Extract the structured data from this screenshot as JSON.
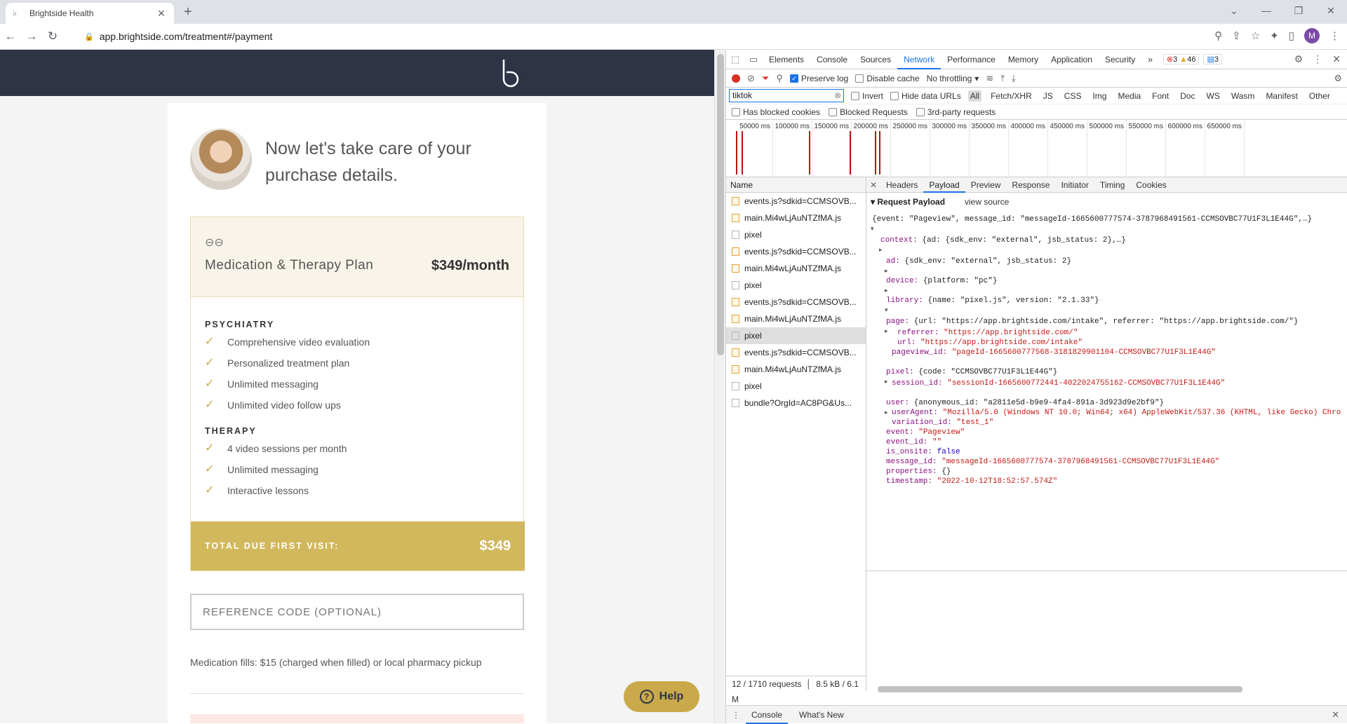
{
  "browser": {
    "tab_title": "Brightside Health",
    "url": "app.brightside.com/treatment#/payment",
    "avatar_letter": "M"
  },
  "page": {
    "heading": "Now let's take care of your purchase details.",
    "plan_name": "Medication & Therapy Plan",
    "plan_price": "$349/month",
    "psychiatry_label": "PSYCHIATRY",
    "psychiatry_items": [
      "Comprehensive video evaluation",
      "Personalized treatment plan",
      "Unlimited messaging",
      "Unlimited video follow ups"
    ],
    "therapy_label": "THERAPY",
    "therapy_items": [
      "4 video sessions per month",
      "Unlimited messaging",
      "Interactive lessons"
    ],
    "total_label": "TOTAL DUE FIRST VISIT:",
    "total_amount": "$349",
    "reference_placeholder": "REFERENCE CODE (OPTIONAL)",
    "medication_note": "Medication fills: $15 (charged when filled) or local pharmacy pickup",
    "help_label": "Help",
    "accent_color": "#c9a94a",
    "header_color": "#2e3346"
  },
  "devtools": {
    "tabs": [
      "Elements",
      "Console",
      "Sources",
      "Network",
      "Performance",
      "Memory",
      "Application",
      "Security"
    ],
    "active_tab": "Network",
    "badges": {
      "errors": "3",
      "warnings": "46",
      "messages": "3"
    },
    "toolbar": {
      "preserve_log": "Preserve log",
      "disable_cache": "Disable cache",
      "throttling": "No throttling"
    },
    "filter": {
      "value": "tiktok",
      "invert": "Invert",
      "hide_data_urls": "Hide data URLs",
      "types": [
        "All",
        "Fetch/XHR",
        "JS",
        "CSS",
        "Img",
        "Media",
        "Font",
        "Doc",
        "WS",
        "Wasm",
        "Manifest",
        "Other"
      ],
      "has_blocked_cookies": "Has blocked cookies",
      "blocked_requests": "Blocked Requests",
      "third_party": "3rd-party requests"
    },
    "timeline_ticks": [
      "50000 ms",
      "100000 ms",
      "150000 ms",
      "200000 ms",
      "250000 ms",
      "300000 ms",
      "350000 ms",
      "400000 ms",
      "450000 ms",
      "500000 ms",
      "550000 ms",
      "600000 ms",
      "650000 ms"
    ],
    "name_header": "Name",
    "requests": [
      {
        "name": "events.js?sdkid=CCMSOVB...",
        "type": "js"
      },
      {
        "name": "main.Mi4wLjAuNTZfMA.js",
        "type": "js"
      },
      {
        "name": "pixel",
        "type": "doc"
      },
      {
        "name": "events.js?sdkid=CCMSOVB...",
        "type": "js"
      },
      {
        "name": "main.Mi4wLjAuNTZfMA.js",
        "type": "js"
      },
      {
        "name": "pixel",
        "type": "doc"
      },
      {
        "name": "events.js?sdkid=CCMSOVB...",
        "type": "js"
      },
      {
        "name": "main.Mi4wLjAuNTZfMA.js",
        "type": "js"
      },
      {
        "name": "pixel",
        "type": "doc",
        "selected": true
      },
      {
        "name": "events.js?sdkid=CCMSOVB...",
        "type": "js"
      },
      {
        "name": "main.Mi4wLjAuNTZfMA.js",
        "type": "js"
      },
      {
        "name": "pixel",
        "type": "doc"
      },
      {
        "name": "bundle?OrgId=AC8PG&Us...",
        "type": "doc"
      }
    ],
    "footer_requests": "12 / 1710 requests",
    "footer_size": "8.5 kB / 6.1 M",
    "detail_tabs": [
      "Headers",
      "Payload",
      "Preview",
      "Response",
      "Initiator",
      "Timing",
      "Cookies"
    ],
    "active_detail_tab": "Payload",
    "payload_title": "Request Payload",
    "view_source": "view source",
    "payload_lines": [
      {
        "k": "",
        "v": "{event: \"Pageview\", message_id: \"messageId-1665600777574-3787968491561-CCMSOVBC77U1F3L1E44G\",…}"
      },
      {
        "k": "context: ",
        "v": "{ad: {sdk_env: \"external\", jsb_status: 2},…}"
      },
      {
        "k": "ad: ",
        "v": "{sdk_env: \"external\", jsb_status: 2}"
      },
      {
        "k": "device: ",
        "v": "{platform: \"pc\"}"
      },
      {
        "k": "library: ",
        "v": "{name: \"pixel.js\", version: \"2.1.33\"}"
      },
      {
        "k": "page: ",
        "v": "{url: \"https://app.brightside.com/intake\", referrer: \"https://app.brightside.com/\"}"
      },
      {
        "k": "referrer: ",
        "v": "\"https://app.brightside.com/\""
      },
      {
        "k": "url: ",
        "v": "\"https://app.brightside.com/intake\""
      },
      {
        "k": "pageview_id: ",
        "v": "\"pageId-1665600777568-3181829901104-CCMSOVBC77U1F3L1E44G\""
      },
      {
        "k": "pixel: ",
        "v": "{code: \"CCMSOVBC77U1F3L1E44G\"}"
      },
      {
        "k": "session_id: ",
        "v": "\"sessionId-1665600772441-4022024755162-CCMSOVBC77U1F3L1E44G\""
      },
      {
        "k": "user: ",
        "v": "{anonymous_id: \"a2811e5d-b9e9-4fa4-891a-3d923d9e2bf9\"}"
      },
      {
        "k": "userAgent: ",
        "v": "\"Mozilla/5.0 (Windows NT 10.0; Win64; x64) AppleWebKit/537.36 (KHTML, like Gecko) Chro"
      },
      {
        "k": "variation_id: ",
        "v": "\"test_1\""
      },
      {
        "k": "event: ",
        "v": "\"Pageview\""
      },
      {
        "k": "event_id: ",
        "v": "\"\""
      },
      {
        "k": "is_onsite: ",
        "v": "false"
      },
      {
        "k": "message_id: ",
        "v": "\"messageId-1665600777574-3787968491561-CCMSOVBC77U1F3L1E44G\""
      },
      {
        "k": "properties: ",
        "v": "{}"
      },
      {
        "k": "timestamp: ",
        "v": "\"2022-10-12T18:52:57.574Z\""
      }
    ],
    "drawer_tabs": [
      "Console",
      "What's New"
    ]
  }
}
